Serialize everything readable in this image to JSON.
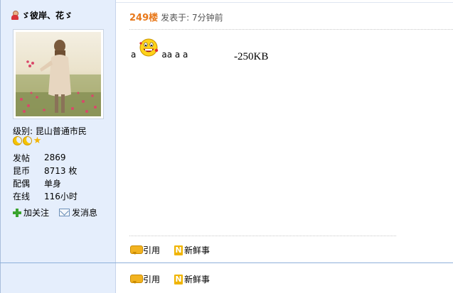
{
  "user": {
    "name": "ゞ彼岸、花ゞ",
    "level_label": "级别:",
    "level_value": "昆山普通市民",
    "rank_icons": [
      "moon-icon",
      "moon-icon",
      "star-icon"
    ],
    "stats": [
      {
        "key": "发帖",
        "value": "2869"
      },
      {
        "key": "昆币",
        "value": "8713 枚"
      },
      {
        "key": "配偶",
        "value": "单身"
      },
      {
        "key": "在线",
        "value": "116小时"
      }
    ],
    "actions": {
      "follow": "加关注",
      "message": "发消息"
    }
  },
  "post": {
    "floor": "249楼",
    "posted_at": "发表于: 7分钟前",
    "content_before": "a",
    "content_after": "aa a a",
    "size_note": "-250KB"
  },
  "toolbar": {
    "quote": "引用",
    "news": "新鲜事",
    "news_icon_letter": "N"
  },
  "colors": {
    "sidebar_bg": "#e5eefc",
    "floor_orange": "#e8781a",
    "divider_blue": "#8eb0da"
  }
}
